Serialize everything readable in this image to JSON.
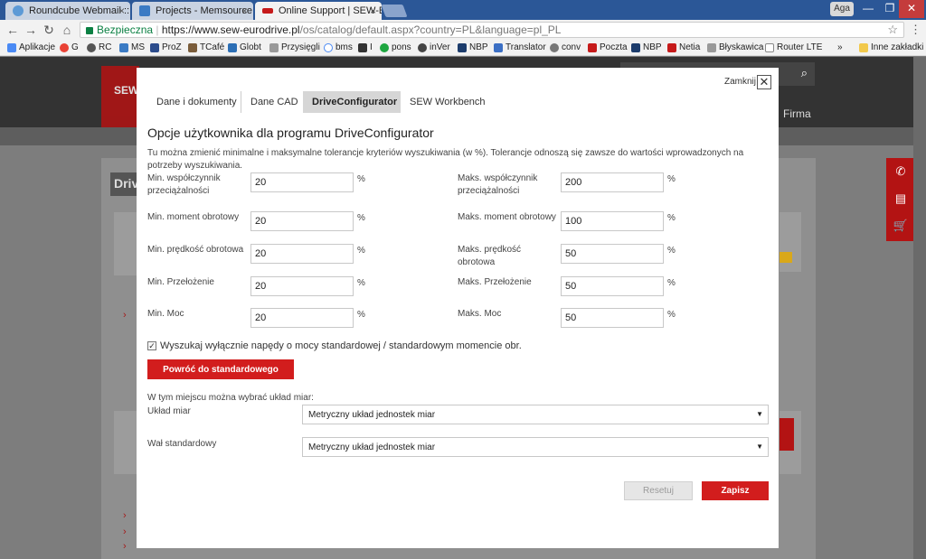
{
  "browser": {
    "tabs": [
      {
        "title": "Roundcube Webmail :: C",
        "close": "×"
      },
      {
        "title": "Projects - Memsource",
        "close": "×"
      },
      {
        "title": "Online Support | SEW-EU",
        "close": "×"
      }
    ],
    "profile": "Aga",
    "window_controls": {
      "minimize": "—",
      "maximize": "❐",
      "close": "✕"
    },
    "secure_label": "Bezpieczna",
    "url_host": "https://www.sew-eurodrive.pl",
    "url_path": "/os/catalog/default.aspx?country=PL&language=pl_PL",
    "nav": {
      "back": "←",
      "forward": "→",
      "reload": "↻",
      "home": "⌂",
      "star": "☆",
      "menu": "⋮"
    },
    "bookmarks": [
      "Aplikacje",
      "G",
      "RC",
      "MS",
      "ProZ",
      "TCafé",
      "Globt",
      "Przysięgli",
      "bms",
      "I",
      "pons",
      "inVer",
      "NBP",
      "Translator",
      "conv",
      "Poczta",
      "NBP",
      "Netia",
      "Błyskawica",
      "Router LTE"
    ],
    "bookmarks_more": "»",
    "other_bookmarks": "Inne zakładki"
  },
  "site": {
    "logo": "SEW",
    "firma": "Firma",
    "driv": "Driv",
    "sidebar_icons": [
      "✆",
      "▤",
      "🛒"
    ],
    "search_icon": "⌕"
  },
  "modal": {
    "close_label": "Zamknij",
    "close_glyph": "✕",
    "tabs": [
      "Dane i dokumenty",
      "Dane CAD",
      "DriveConfigurator",
      "SEW Workbench"
    ],
    "title": "Opcje użytkownika dla programu DriveConfigurator",
    "description": "Tu można zmienić minimalne i maksymalne tolerancje kryteriów wyszukiwania (w %). Tolerancje odnoszą się zawsze do wartości wprowadzonych na potrzeby wyszukiwania.",
    "unit": "%",
    "fields_left": [
      {
        "label": "Min. współczynnik przeciążalności",
        "value": "20"
      },
      {
        "label": "Min. moment obrotowy",
        "value": "20"
      },
      {
        "label": "Min. prędkość obrotowa",
        "value": "20"
      },
      {
        "label": "Min. Przełożenie",
        "value": "20"
      },
      {
        "label": "Min. Moc",
        "value": "20"
      }
    ],
    "fields_right": [
      {
        "label": "Maks. współczynnik przeciążalności",
        "value": "200"
      },
      {
        "label": "Maks. moment obrotowy",
        "value": "100"
      },
      {
        "label": "Maks. prędkość obrotowa",
        "value": "50"
      },
      {
        "label": "Maks. Przełożenie",
        "value": "50"
      },
      {
        "label": "Maks. Moc",
        "value": "50"
      }
    ],
    "checkbox_label": "Wyszukaj wyłącznie napędy o mocy standardowej / standardowym momencie obr.",
    "checkbox_checked": "✓",
    "restore_button": "Powróć do standardowego",
    "units_intro": "W tym miejscu można wybrać układ miar:",
    "selects": [
      {
        "label": "Układ miar",
        "value": "Metryczny układ jednostek miar"
      },
      {
        "label": "Wał standardowy",
        "value": "Metryczny układ jednostek miar"
      }
    ],
    "caret": "▼",
    "reset_button": "Resetuj",
    "save_button": "Zapisz"
  }
}
